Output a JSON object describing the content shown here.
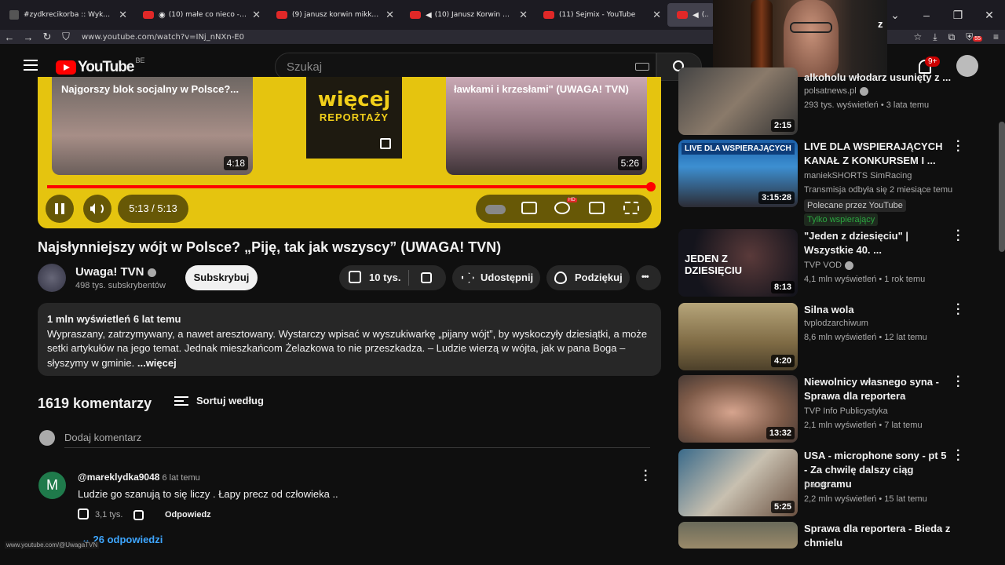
{
  "tabs": [
    {
      "title": "#zydkrecikorba :: Wykop.pl",
      "type": "wykop"
    },
    {
      "title": "(10) małe co nieco - YouTube",
      "type": "yt"
    },
    {
      "title": "(9) janusz korwin mikke aliment",
      "type": "yt"
    },
    {
      "title": "(10) Janusz Korwin Mikke O",
      "type": "yt"
    },
    {
      "title": "(11) Sejmix - YouTube",
      "type": "yt"
    },
    {
      "title": "(11)",
      "type": "yt-active"
    }
  ],
  "browser": {
    "url": "www.youtube.com/watch?v=INj_nNXn-E0",
    "ext_badge": "55"
  },
  "header": {
    "logo": "YouTube",
    "country": "BE",
    "search_placeholder": "Szukaj",
    "notif_count": "9+",
    "partial": "z"
  },
  "player": {
    "left_caption": "Najgorszy blok socjalny w Polsce?...",
    "left_duration": "4:18",
    "center_line1": "więcej",
    "center_line2": "REPORTAŻY",
    "right_caption": "ławkami i krzesłami\" (UWAGA! TVN)",
    "right_duration": "5:26",
    "time": "5:13 / 5:13",
    "progress_pct": 100
  },
  "video": {
    "title": "Najsłynniejszy wójt w Polsce? „Piję, tak jak wszyscy” (UWAGA! TVN)",
    "channel": "Uwaga! TVN",
    "subs": "498 tys. subskrybentów",
    "subscribe": "Subskrybuj",
    "likes": "10 tys.",
    "share": "Udostępnij",
    "thanks": "Podziękuj"
  },
  "description": {
    "meta": "1 mln wyświetleń  6 lat temu",
    "line1": "Wypraszany, zatrzymywany, a nawet aresztowany. Wystarczy wpisać w wyszukiwarkę „pijany wójt”, by wyskoczyły dziesiątki, a może",
    "line2": "setki artykułów na jego temat. Jednak mieszkańcom Żelazkowa to nie przeszkadza. – Ludzie wierzą w wójta, jak w pana Boga –",
    "line3": "słyszymy w gminie.",
    "more": " ...więcej"
  },
  "comments": {
    "count": "1619 komentarzy",
    "sort": "Sortuj według",
    "add": "Dodaj komentarz",
    "items": [
      {
        "initial": "M",
        "author": "@mareklydka9048",
        "time": "6 lat temu",
        "text": "Ludzie go szanują to się liczy . Łapy precz od człowieka ..",
        "likes": "3,1 tys.",
        "reply": "Odpowiedz",
        "replies": "26 odpowiedzi"
      }
    ]
  },
  "status_url": "www.youtube.com/@UwagaTVN",
  "recommendations": [
    {
      "title": "alkoholu włodarz usunięty z ...",
      "channel": "polsatnews.pl",
      "verified": true,
      "meta": "293 tys. wyświetleń • 3 lata temu",
      "duration": "2:15"
    },
    {
      "title": "LIVE DLA WSPIERAJĄCYCH KANAŁ Z KONKURSEM I ...",
      "channel": "maniekSHORTS SimRacing",
      "meta": "Transmisja odbyła się 2 miesiące temu",
      "duration": "3:15:28",
      "thumb_text": "LIVE DLA WSPIERAJĄCYCH",
      "tag1": "Polecane przez YouTube",
      "tag2": "Tylko wspierający"
    },
    {
      "title": "\"Jeden z dziesięciu\" | Wszystkie 40. ...",
      "channel": "TVP VOD",
      "verified": true,
      "meta": "4,1 mln wyświetleń • 1 rok temu",
      "duration": "8:13",
      "thumb_text": "JEDEN Z DZIESIĘCIU"
    },
    {
      "title": "Silna wola",
      "channel": "tvplodzarchiwum",
      "meta": "8,6 mln wyświetleń • 12 lat temu",
      "duration": "4:20"
    },
    {
      "title": "Niewolnicy własnego syna - Sprawa dla reportera",
      "channel": "TVP Info Publicystyka",
      "meta": "2,1 mln wyświetleń • 7 lat temu",
      "duration": "13:32"
    },
    {
      "title": "USA - microphone sony - pt 5 - Za chwilę dalszy ciąg programu",
      "channel": "Darek",
      "meta": "2,2 mln wyświetleń • 15 lat temu",
      "duration": "5:25"
    },
    {
      "title": "Sprawa dla reportera - Bieda z chmielu",
      "channel": "",
      "meta": "",
      "duration": ""
    }
  ],
  "colors": {
    "accent": "#ff0000",
    "link": "#3ea6ff",
    "player_bg": "#e5c40f"
  },
  "icons": [
    "menu-icon",
    "search-icon",
    "keyboard-icon",
    "bell-icon",
    "play-pause-icon",
    "volume-icon",
    "subtitles-icon",
    "settings-icon",
    "theater-icon",
    "fullscreen-icon",
    "like-icon",
    "dislike-icon",
    "share-icon",
    "thanks-icon",
    "sort-icon",
    "kebab-icon"
  ]
}
